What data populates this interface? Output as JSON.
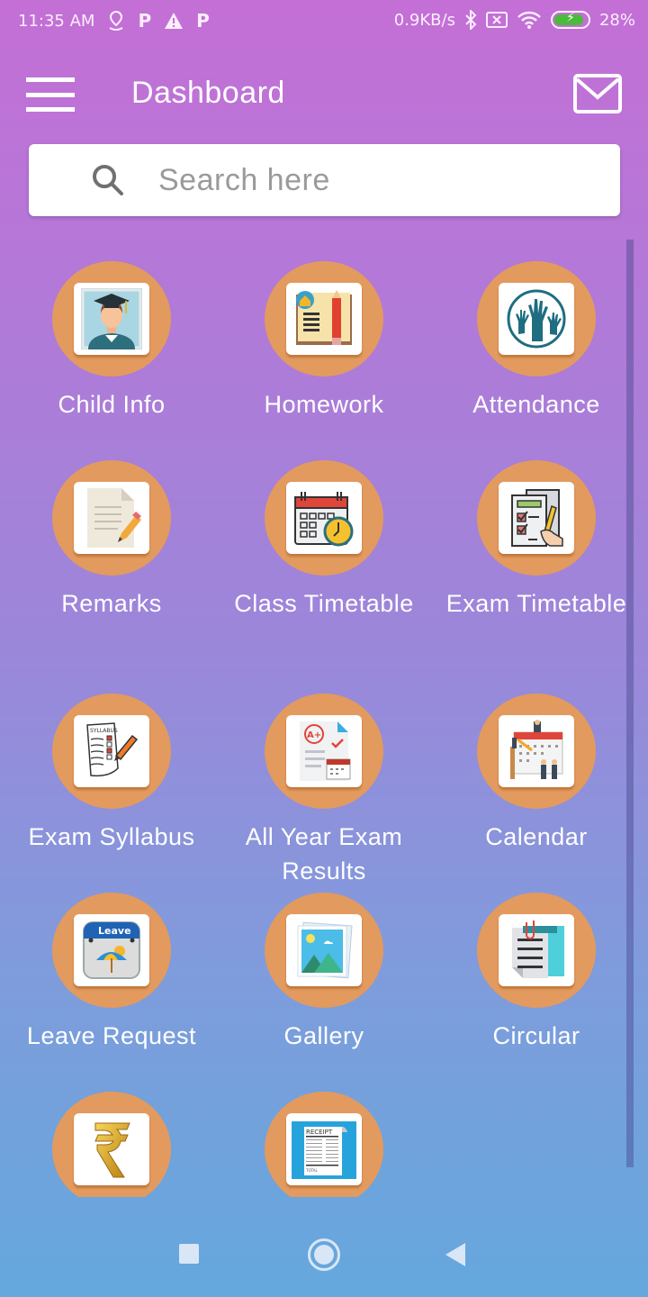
{
  "status_bar": {
    "time": "11:35 AM",
    "notification_icons": [
      "location-pin-icon",
      "p-app-icon",
      "warning-icon",
      "p-app-icon"
    ],
    "network_speed": "0.9KB/s",
    "system_icons": [
      "bluetooth-icon",
      "no-sim-icon",
      "wifi-icon"
    ],
    "battery_percent": "28%",
    "battery_level": 0.28,
    "battery_charging": true
  },
  "app_bar": {
    "title": "Dashboard",
    "menu_icon": "hamburger-menu-icon",
    "mail_icon": "mail-icon"
  },
  "search": {
    "placeholder": "Search here",
    "value": ""
  },
  "colors": {
    "gradient_top": "#c46fd6",
    "gradient_bottom": "#64a8dd",
    "tile_circle": "#e39a5e"
  },
  "tiles": [
    {
      "label": "Child Info",
      "icon": "student-graduate-icon"
    },
    {
      "label": "Homework",
      "icon": "book-pencil-icon"
    },
    {
      "label": "Attendance",
      "icon": "raised-hands-icon"
    },
    {
      "label": "Remarks",
      "icon": "document-pencil-icon"
    },
    {
      "label": "Class Timetable",
      "icon": "calendar-clock-icon"
    },
    {
      "label": "Exam Timetable",
      "icon": "exam-checklist-icon"
    },
    {
      "label": "Exam Syllabus",
      "icon": "syllabus-icon"
    },
    {
      "label": "All Year Exam Results",
      "icon": "grade-a-plus-icon"
    },
    {
      "label": "Calendar",
      "icon": "calendar-people-icon"
    },
    {
      "label": "Leave Request",
      "icon": "leave-calendar-icon"
    },
    {
      "label": "Gallery",
      "icon": "picture-gallery-icon"
    },
    {
      "label": "Circular",
      "icon": "clipped-document-icon"
    },
    {
      "label": "",
      "icon": "rupee-icon"
    },
    {
      "label": "",
      "icon": "receipt-icon"
    }
  ],
  "receipt_icon_text": {
    "title": "RECEIPT",
    "total": "TOTAL"
  },
  "leave_icon_text": "Leave",
  "syllabus_icon_text": "SYLLABUS",
  "nav_bar": {
    "recents": "recents-icon",
    "home": "home-icon",
    "back": "back-icon"
  }
}
